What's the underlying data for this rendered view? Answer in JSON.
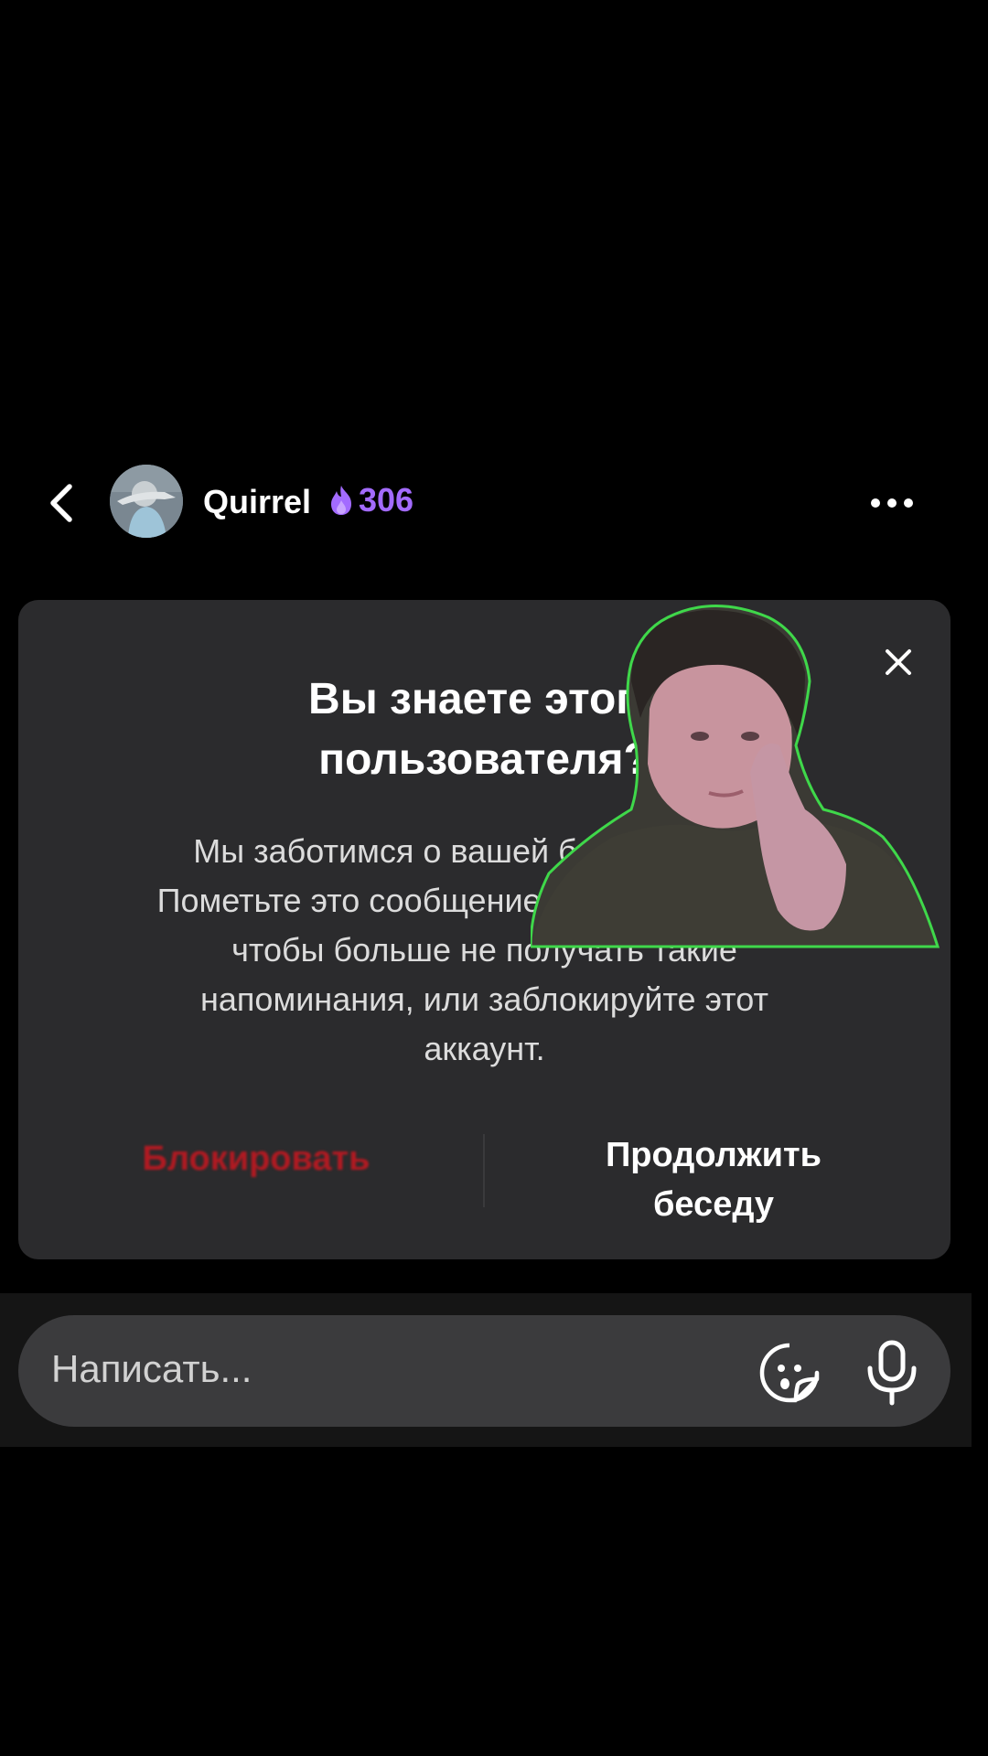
{
  "header": {
    "username": "Quirrel",
    "streak_count": "306",
    "streak_color": "#a36bff"
  },
  "modal": {
    "title_line1": "Вы знаете этого",
    "title_line2": "пользователя?",
    "body_line1": "Мы заботимся о вашей безопасности.",
    "body_line2": "Пометьте это сообщение как прочитанное,",
    "body_line3": "чтобы больше не получать такие",
    "body_line4": "напоминания, или заблокируйте этот",
    "body_line5": "аккаунт.",
    "block_label": "Блокировать",
    "continue_line1": "Продолжить",
    "continue_line2": "беседу",
    "block_color": "#b01a22"
  },
  "composer": {
    "placeholder": "Написать..."
  },
  "icons": {
    "back": "chevron-left-icon",
    "more": "more-dots-icon",
    "close": "close-icon",
    "streak": "flame-icon",
    "sticker": "sticker-icon",
    "mic": "microphone-icon"
  }
}
